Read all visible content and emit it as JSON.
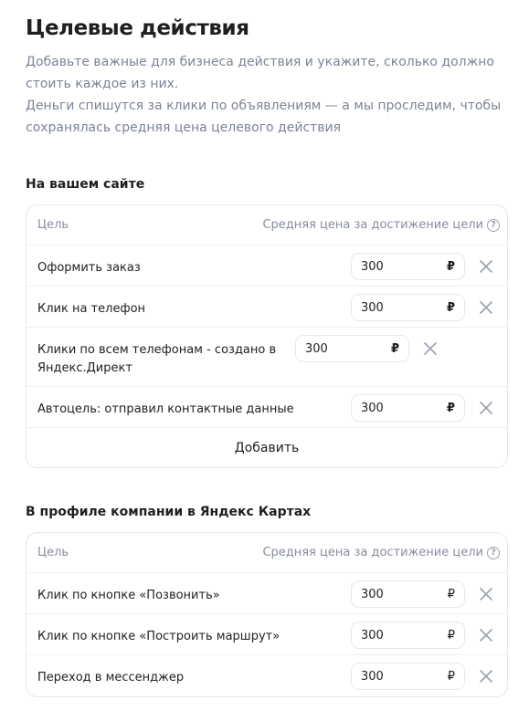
{
  "page": {
    "title": "Целевые действия",
    "description_1": "Добавьте важные для бизнеса действия и укажите, сколько должно стоить каждое из них.",
    "description_2": "Деньги спишутся за клики по объявлениям — а мы проследим, чтобы сохранялась средняя цена целевого действия"
  },
  "site_section": {
    "title": "На вашем сайте",
    "col_goal": "Цель",
    "col_price": "Средняя цена за достижение цели",
    "rows": [
      {
        "label": "Оформить заказ",
        "value": "300",
        "currency": "₽"
      },
      {
        "label": "Клик на телефон",
        "value": "300",
        "currency": "₽"
      },
      {
        "label": "Клики по всем телефонам - создано в Яндекс.Директ",
        "value": "300",
        "currency": "₽"
      },
      {
        "label": "Автоцель: отправил контактные данные",
        "value": "300",
        "currency": "₽"
      }
    ],
    "add_label": "Добавить"
  },
  "maps_section": {
    "title": "В профиле компании в Яндекс Картах",
    "col_goal": "Цель",
    "col_price": "Средняя цена за достижение цели",
    "rows": [
      {
        "label": "Клик по кнопке «Позвонить»",
        "value": "300",
        "currency": "₽"
      },
      {
        "label": "Клик по кнопке «Построить маршрут»",
        "value": "300",
        "currency": "₽"
      },
      {
        "label": "Переход в мессенджер",
        "value": "300",
        "currency": "₽"
      }
    ]
  },
  "icons": {
    "help": "help-circle-icon",
    "remove": "close-icon"
  },
  "colors": {
    "text": "#1f1f1f",
    "muted": "#7b8495",
    "border": "#e6e8ec",
    "icon": "#9aa1ad"
  }
}
